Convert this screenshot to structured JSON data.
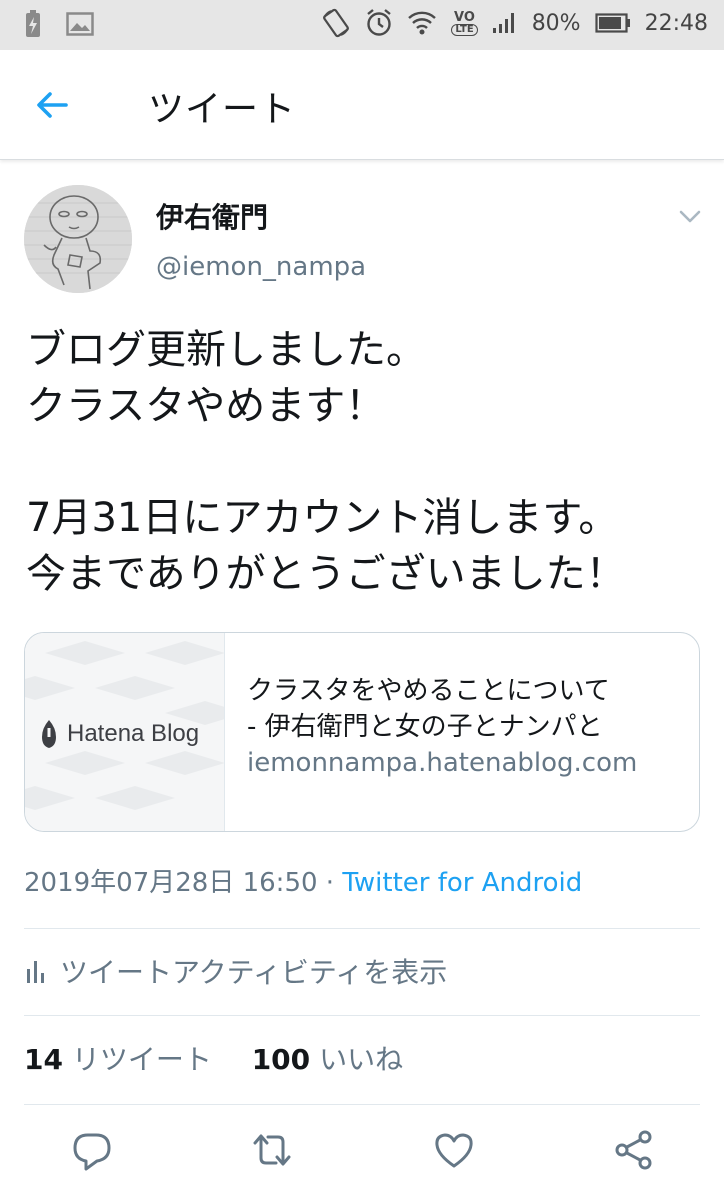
{
  "status_bar": {
    "battery_percent": "80%",
    "time": "22:48",
    "volte_top": "VO",
    "volte_bottom": "LTE"
  },
  "header": {
    "title": "ツイート"
  },
  "tweet": {
    "user_name": "伊右衛門",
    "user_handle": "@iemon_nampa",
    "lines": [
      "ブログ更新しました。",
      "クラスタやめます！",
      "",
      "7月31日にアカウント消します。",
      "今までありがとうございました！"
    ]
  },
  "card": {
    "logo_text": "Hatena Blog",
    "title_line1": "クラスタをやめることについて",
    "title_line2": "- 伊右衛門と女の子とナンパと",
    "url": "iemonnampa.hatenablog.com"
  },
  "meta": {
    "timestamp": "2019年07月28日 16:50",
    "separator": " · ",
    "source": "Twitter for Android"
  },
  "activity": {
    "label": "ツイートアクティビティを表示"
  },
  "stats": {
    "retweet_count": "14",
    "retweet_label": "リツイート",
    "like_count": "100",
    "like_label": "いいね"
  },
  "colors": {
    "accent": "#1da1f2",
    "secondary_text": "#657786",
    "icon_gray": "#657786"
  }
}
